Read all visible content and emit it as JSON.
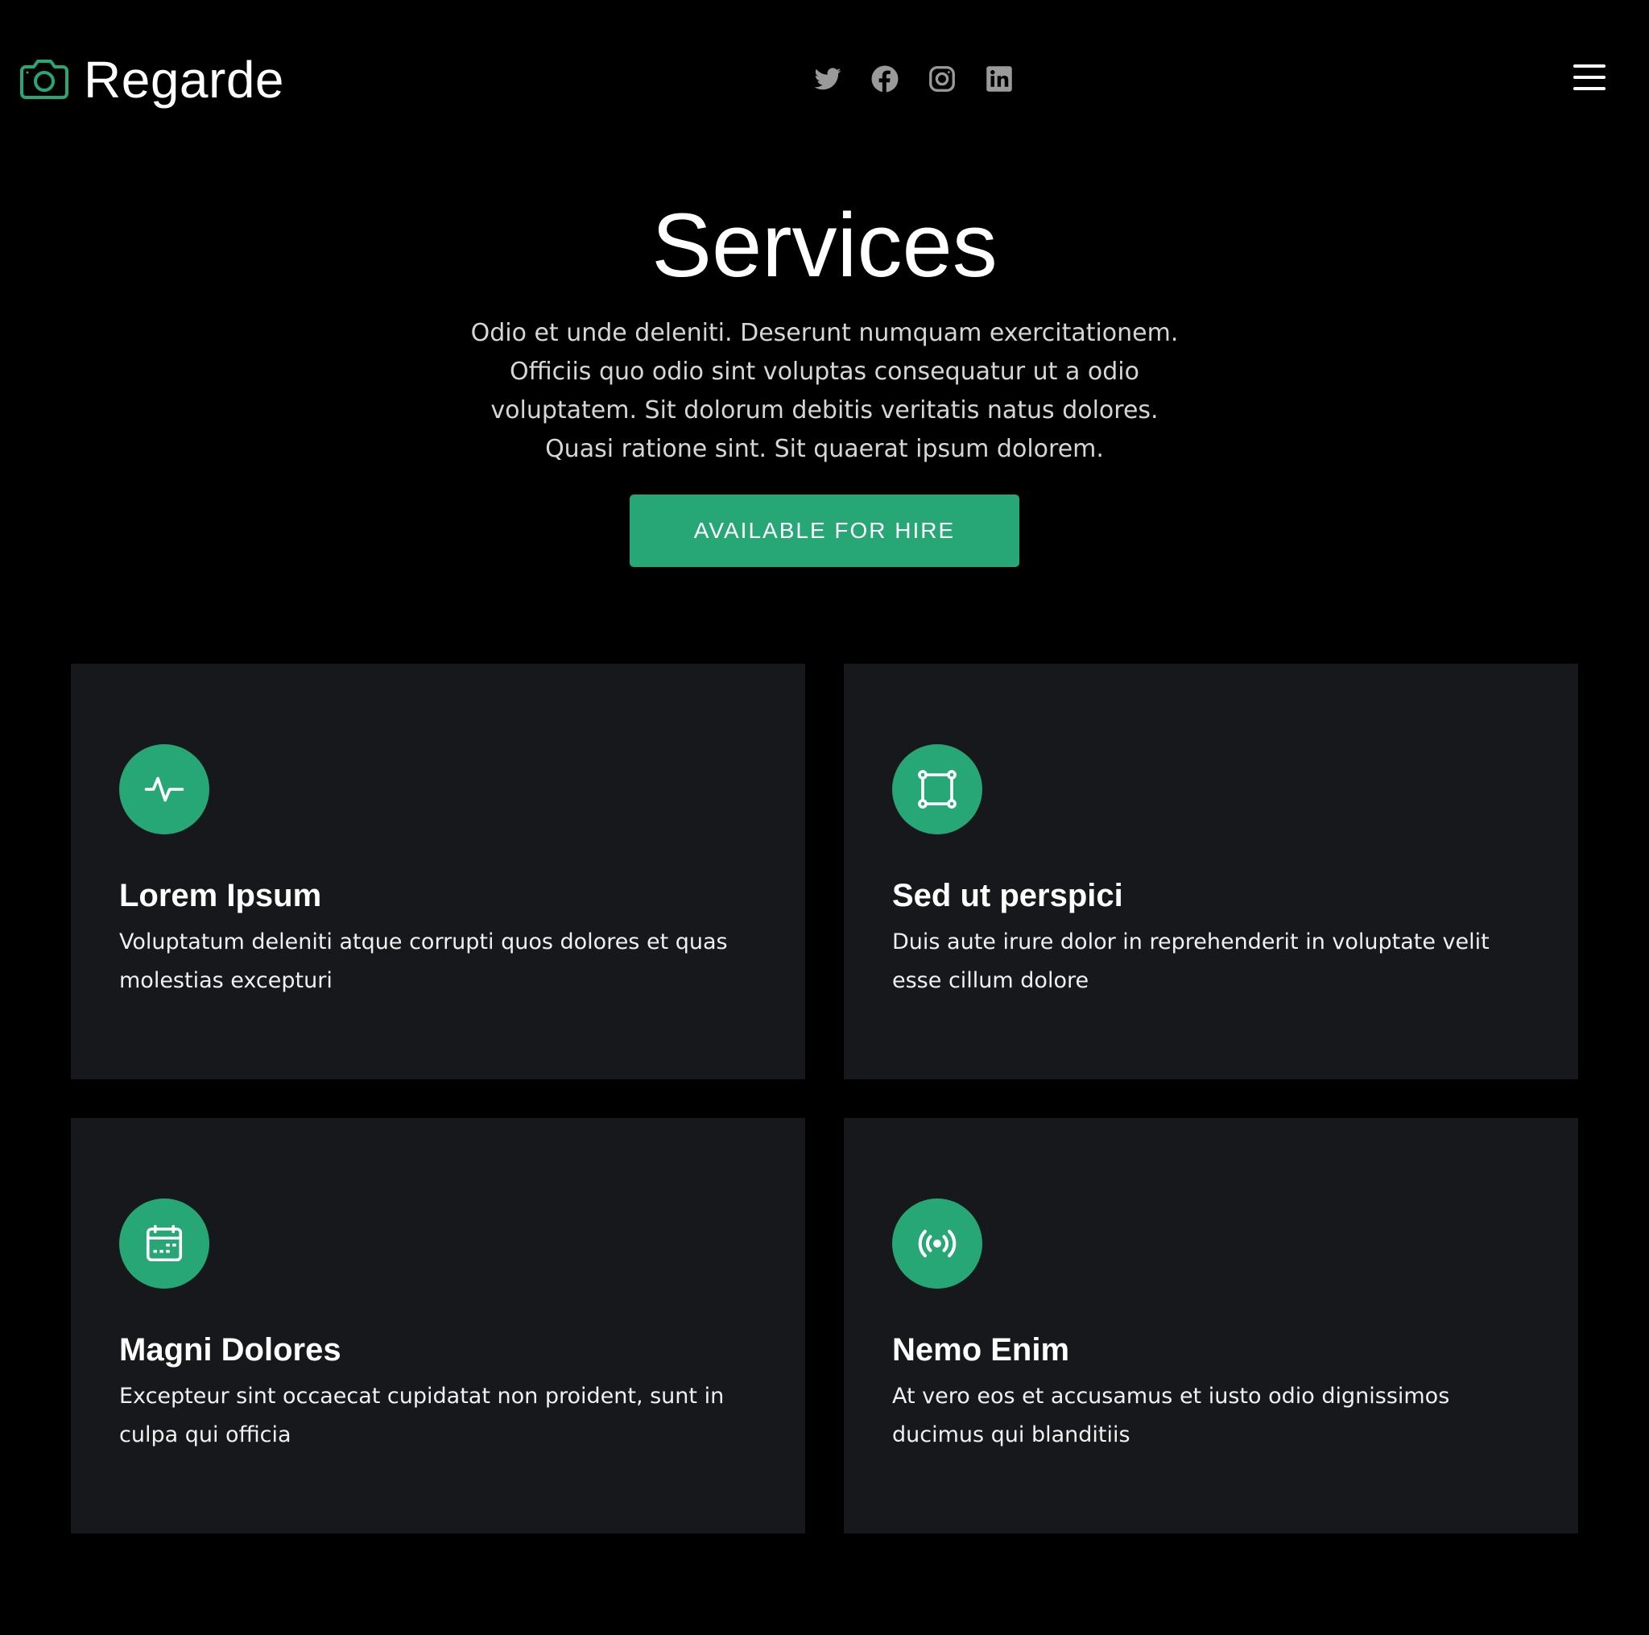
{
  "brand": {
    "name": "Regarde",
    "icon": "camera-icon",
    "accent_color": "#27a776"
  },
  "socials": [
    {
      "name": "twitter",
      "icon": "twitter-icon"
    },
    {
      "name": "facebook",
      "icon": "facebook-icon"
    },
    {
      "name": "instagram",
      "icon": "instagram-icon"
    },
    {
      "name": "linkedin",
      "icon": "linkedin-icon"
    }
  ],
  "menu": {
    "icon": "hamburger-menu-icon"
  },
  "hero": {
    "title": "Services",
    "description": "Odio et unde deleniti. Deserunt numquam exercitationem. Officiis quo odio sint voluptas consequatur ut a odio voluptatem. Sit dolorum debitis veritatis natus dolores. Quasi ratione sint. Sit quaerat ipsum dolorem.",
    "button_label": "AVAILABLE FOR HIRE"
  },
  "services": [
    {
      "title": "Lorem Ipsum",
      "text": "Voluptatum deleniti atque corrupti quos dolores et quas molestias excepturi",
      "icon": "activity-icon"
    },
    {
      "title": "Sed ut perspici",
      "text": "Duis aute irure dolor in reprehenderit in voluptate velit esse cillum dolore",
      "icon": "bounding-box-icon"
    },
    {
      "title": "Magni Dolores",
      "text": "Excepteur sint occaecat cupidatat non proident, sunt in culpa qui officia",
      "icon": "calendar-icon"
    },
    {
      "title": "Nemo Enim",
      "text": "At vero eos et accusamus et iusto odio dignissimos ducimus qui blanditiis",
      "icon": "broadcast-icon"
    }
  ]
}
